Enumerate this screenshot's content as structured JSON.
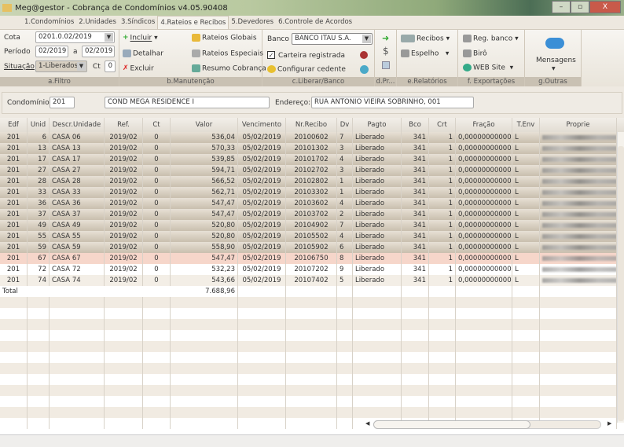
{
  "window": {
    "title": "Meg@gestor - Cobrança de Condomínios v4.05.90408",
    "min": "–",
    "max": "▫",
    "close": "X"
  },
  "tabs": [
    {
      "label": "1.Condomínios"
    },
    {
      "label": "2.Unidades"
    },
    {
      "label": "3.Síndicos"
    },
    {
      "label": "4.Rateios e Recibos",
      "active": true
    },
    {
      "label": "5.Devedores"
    },
    {
      "label": "6.Controle de Acordos"
    }
  ],
  "filtro": {
    "cota_label": "Cota",
    "cota_value": "0201.0.02/2019",
    "periodo_label": "Período",
    "periodo_from": "02/2019",
    "a_label": "a",
    "periodo_to": "02/2019",
    "situacao_label": "Situação",
    "situacao_value": "1-Liberados",
    "ct_label": "Ct",
    "ct_value": "0",
    "group": "a.Filtro"
  },
  "manutencao": {
    "incluir": "Incluir",
    "detalhar": "Detalhar",
    "excluir": "Excluir",
    "rateios_globais": "Rateios Globais",
    "rateios_especiais": "Rateios Especiais",
    "resumo": "Resumo Cobrança",
    "group": "b.Manutenção"
  },
  "banco": {
    "label": "Banco",
    "value": "BANCO ITAU S.A.",
    "carteira": "Carteira registrada",
    "carteira_checked": true,
    "configurar": "Configurar cedente",
    "group": "c.Liberar/Banco"
  },
  "dpr": {
    "dollar": "$",
    "group": "d.Pr..."
  },
  "relatorios": {
    "recibos": "Recibos",
    "espelho": "Espelho",
    "group": "e.Relatórios"
  },
  "exportacoes": {
    "reg_banco": "Reg. banco",
    "biro": "Birô",
    "web": "WEB Site",
    "group": "f. Exportações"
  },
  "outras": {
    "mensagens": "Mensagens",
    "group": "g.Outras"
  },
  "condominio": {
    "label": "Condomínio:",
    "code": "201",
    "name": "COND MEGA RESIDENCE I",
    "endereco_label": "Endereço:",
    "endereco": "RUA ANTONIO VIEIRA SOBRINHO, 001"
  },
  "grid": {
    "columns": [
      "Edf",
      "Unid",
      "Descr.Unidade",
      "Ref.",
      "Ct",
      "Valor",
      "Vencimento",
      "Nr.Recibo",
      "Dv",
      "Pagto",
      "Bco",
      "Crt",
      "Fração",
      "T.Env",
      "Proprie"
    ],
    "rows": [
      [
        "201",
        "6",
        "CASA 06",
        "2019/02",
        "0",
        "536,04",
        "05/02/2019",
        "20100602",
        "7",
        "Liberado",
        "341",
        "1",
        "0,00000000000",
        "L"
      ],
      [
        "201",
        "13",
        "CASA 13",
        "2019/02",
        "0",
        "570,33",
        "05/02/2019",
        "20101302",
        "3",
        "Liberado",
        "341",
        "1",
        "0,00000000000",
        "L"
      ],
      [
        "201",
        "17",
        "CASA 17",
        "2019/02",
        "0",
        "539,85",
        "05/02/2019",
        "20101702",
        "4",
        "Liberado",
        "341",
        "1",
        "0,00000000000",
        "L"
      ],
      [
        "201",
        "27",
        "CASA 27",
        "2019/02",
        "0",
        "594,71",
        "05/02/2019",
        "20102702",
        "3",
        "Liberado",
        "341",
        "1",
        "0,00000000000",
        "L"
      ],
      [
        "201",
        "28",
        "CASA 28",
        "2019/02",
        "0",
        "566,52",
        "05/02/2019",
        "20102802",
        "1",
        "Liberado",
        "341",
        "1",
        "0,00000000000",
        "L"
      ],
      [
        "201",
        "33",
        "CASA 33",
        "2019/02",
        "0",
        "562,71",
        "05/02/2019",
        "20103302",
        "1",
        "Liberado",
        "341",
        "1",
        "0,00000000000",
        "L"
      ],
      [
        "201",
        "36",
        "CASA 36",
        "2019/02",
        "0",
        "547,47",
        "05/02/2019",
        "20103602",
        "4",
        "Liberado",
        "341",
        "1",
        "0,00000000000",
        "L"
      ],
      [
        "201",
        "37",
        "CASA 37",
        "2019/02",
        "0",
        "547,47",
        "05/02/2019",
        "20103702",
        "2",
        "Liberado",
        "341",
        "1",
        "0,00000000000",
        "L"
      ],
      [
        "201",
        "49",
        "CASA 49",
        "2019/02",
        "0",
        "520,80",
        "05/02/2019",
        "20104902",
        "7",
        "Liberado",
        "341",
        "1",
        "0,00000000000",
        "L"
      ],
      [
        "201",
        "55",
        "CASA 55",
        "2019/02",
        "0",
        "520,80",
        "05/02/2019",
        "20105502",
        "4",
        "Liberado",
        "341",
        "1",
        "0,00000000000",
        "L"
      ],
      [
        "201",
        "59",
        "CASA 59",
        "2019/02",
        "0",
        "558,90",
        "05/02/2019",
        "20105902",
        "6",
        "Liberado",
        "341",
        "1",
        "0,00000000000",
        "L"
      ],
      [
        "201",
        "67",
        "CASA 67",
        "2019/02",
        "0",
        "547,47",
        "05/02/2019",
        "20106750",
        "8",
        "Liberado",
        "341",
        "1",
        "0,00000000000",
        "L"
      ],
      [
        "201",
        "72",
        "CASA 72",
        "2019/02",
        "0",
        "532,23",
        "05/02/2019",
        "20107202",
        "9",
        "Liberado",
        "341",
        "1",
        "0,00000000000",
        "L"
      ],
      [
        "201",
        "74",
        "CASA 74",
        "2019/02",
        "0",
        "543,66",
        "05/02/2019",
        "20107402",
        "5",
        "Liberado",
        "341",
        "1",
        "0,00000000000",
        "L"
      ]
    ],
    "selected_row": 11,
    "total_label": "Total",
    "total_value": "7.688,96"
  },
  "colors": {
    "selected_row": "#f6d6ca",
    "released_row": "#d8cfc0"
  }
}
